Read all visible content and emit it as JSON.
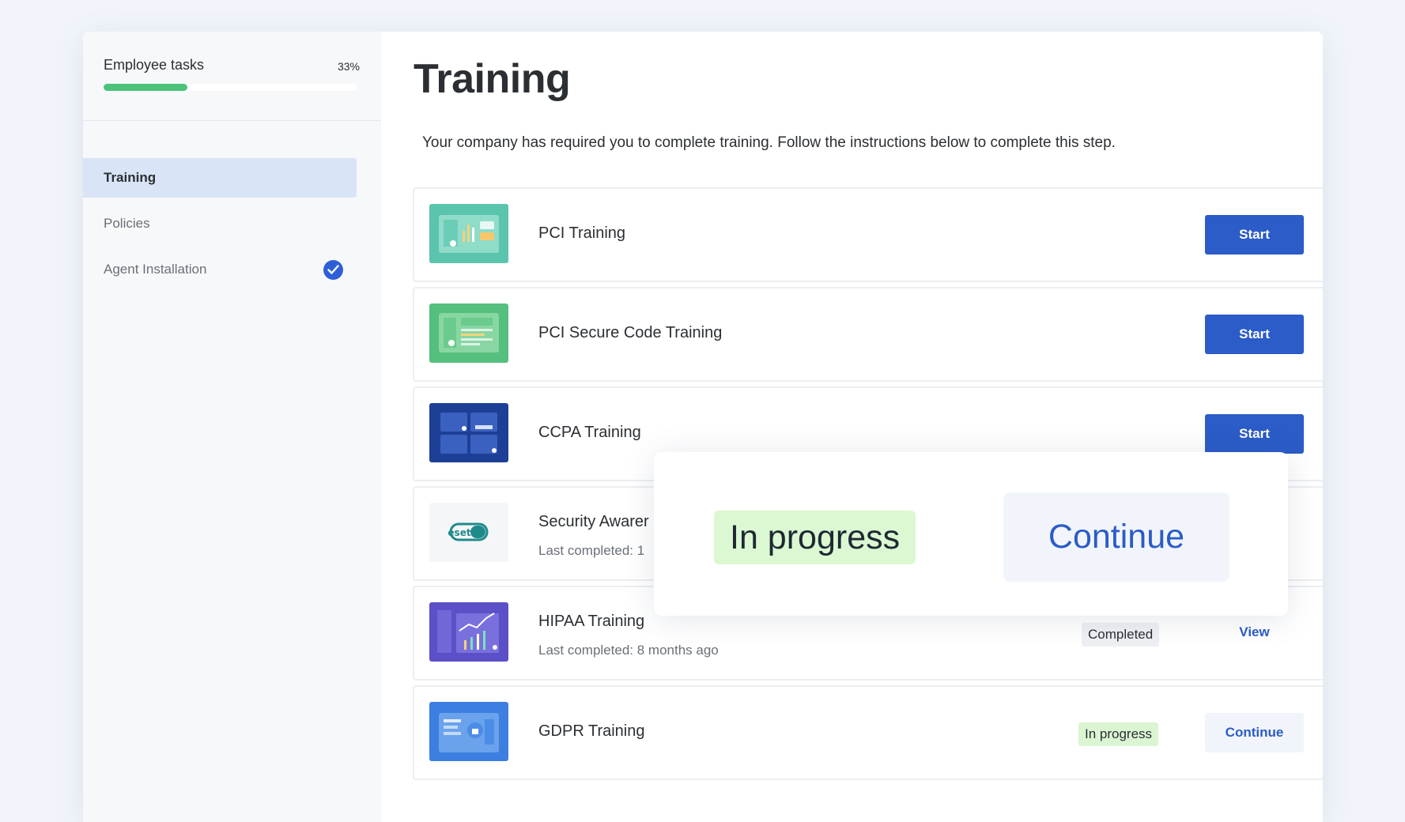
{
  "sidebar": {
    "tasks_title": "Employee tasks",
    "tasks_percent": "33%",
    "progress_fraction": 0.33,
    "items": [
      {
        "label": "Training",
        "active": true,
        "completed": false
      },
      {
        "label": "Policies",
        "active": false,
        "completed": false
      },
      {
        "label": "Agent Installation",
        "active": false,
        "completed": true
      }
    ]
  },
  "main": {
    "title": "Training",
    "subtitle": "Your company has required you to complete training. Follow the instructions below to complete this step.",
    "trainings": [
      {
        "title": "PCI Training",
        "action": "Start",
        "thumb_icon": "pci-training-thumbnail"
      },
      {
        "title": "PCI Secure Code Training",
        "action": "Start",
        "thumb_icon": "pci-secure-code-thumbnail"
      },
      {
        "title": "CCPA Training",
        "action": "Start",
        "thumb_icon": "ccpa-training-thumbnail"
      },
      {
        "title": "Security Awarer",
        "meta": "Last completed: 1",
        "thumb_icon": "eset-logo",
        "logo_text": "eset"
      },
      {
        "title": "HIPAA Training",
        "meta": "Last completed: 8 months ago",
        "status": "Completed",
        "action": "View",
        "thumb_icon": "hipaa-training-thumbnail"
      },
      {
        "title": "GDPR Training",
        "status": "In progress",
        "action": "Continue",
        "thumb_icon": "gdpr-training-thumbnail"
      }
    ]
  },
  "popup": {
    "status": "In progress",
    "action": "Continue"
  },
  "colors": {
    "accent": "#2b5cc7",
    "progress": "#4cc27b",
    "in_progress_bg": "#dbf5d3",
    "active_nav_bg": "#d9e4f7"
  }
}
